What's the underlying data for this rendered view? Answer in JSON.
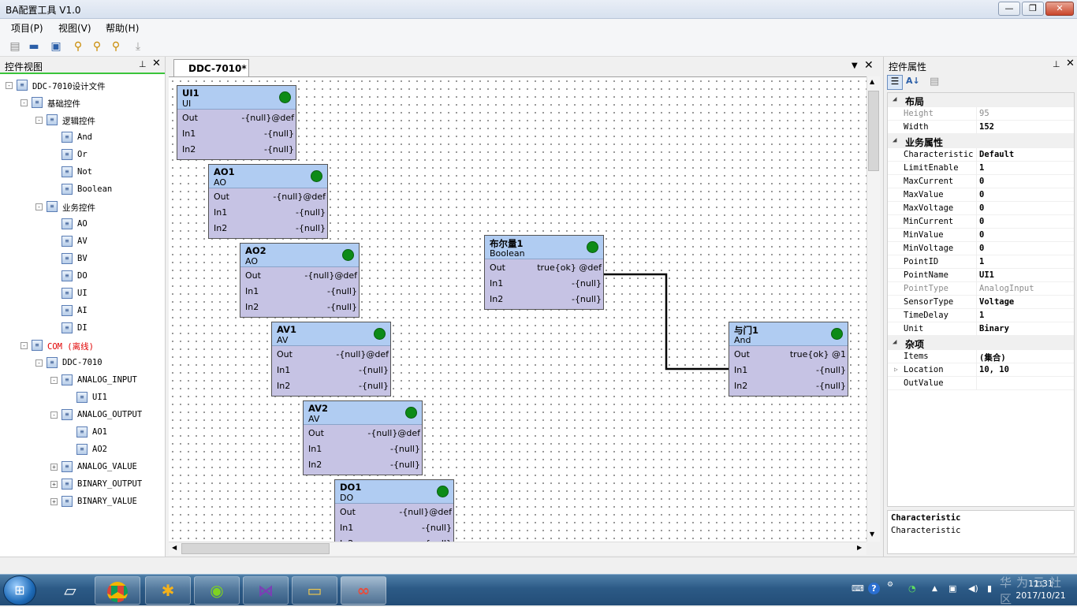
{
  "window": {
    "title": "BA配置工具 V1.0",
    "min": "—",
    "max": "❐",
    "close": "✕"
  },
  "menu": [
    "项目(P)",
    "视图(V)",
    "帮助(H)"
  ],
  "toolbar": [
    "print-icon",
    "open-icon",
    "save-icon",
    "zoom-in-icon",
    "zoom-out-icon",
    "zoom-fit-icon",
    "download-icon"
  ],
  "left_panel": {
    "title": "控件视图",
    "tree": [
      {
        "label": "DDC-7010设计文件",
        "level": 0,
        "exp": "-"
      },
      {
        "label": "基础控件",
        "level": 1,
        "exp": "-"
      },
      {
        "label": "逻辑控件",
        "level": 2,
        "exp": "-"
      },
      {
        "label": "And",
        "level": 3
      },
      {
        "label": "Or",
        "level": 3
      },
      {
        "label": "Not",
        "level": 3
      },
      {
        "label": "Boolean",
        "level": 3
      },
      {
        "label": "业务控件",
        "level": 2,
        "exp": "-"
      },
      {
        "label": "AO",
        "level": 3
      },
      {
        "label": "AV",
        "level": 3
      },
      {
        "label": "BV",
        "level": 3
      },
      {
        "label": "DO",
        "level": 3
      },
      {
        "label": "UI",
        "level": 3
      },
      {
        "label": "AI",
        "level": 3
      },
      {
        "label": "DI",
        "level": 3
      },
      {
        "label": "COM (离线)",
        "level": 1,
        "exp": "-",
        "red": true
      },
      {
        "label": "DDC-7010",
        "level": 2,
        "exp": "-"
      },
      {
        "label": "ANALOG_INPUT",
        "level": 3,
        "exp": "-"
      },
      {
        "label": "UI1",
        "level": 4
      },
      {
        "label": "ANALOG_OUTPUT",
        "level": 3,
        "exp": "-"
      },
      {
        "label": "AO1",
        "level": 4
      },
      {
        "label": "AO2",
        "level": 4
      },
      {
        "label": "ANALOG_VALUE",
        "level": 3,
        "exp": "+"
      },
      {
        "label": "BINARY_OUTPUT",
        "level": 3,
        "exp": "+"
      },
      {
        "label": "BINARY_VALUE",
        "level": 3,
        "exp": "+"
      }
    ]
  },
  "doc_tab": {
    "label": "DDC-7010*"
  },
  "nodes": [
    {
      "title": "UI1",
      "subtitle": "UI",
      "out": "-{null}@def",
      "in1": "-{null}",
      "in2": "-{null}"
    },
    {
      "title": "AO1",
      "subtitle": "AO",
      "out": "-{null}@def",
      "in1": "-{null}",
      "in2": "-{null}"
    },
    {
      "title": "AO2",
      "subtitle": "AO",
      "out": "-{null}@def",
      "in1": "-{null}",
      "in2": "-{null}"
    },
    {
      "title": "AV1",
      "subtitle": "AV",
      "out": "-{null}@def",
      "in1": "-{null}",
      "in2": "-{null}"
    },
    {
      "title": "AV2",
      "subtitle": "AV",
      "out": "-{null}@def",
      "in1": "-{null}",
      "in2": "-{null}"
    },
    {
      "title": "DO1",
      "subtitle": "DO",
      "out": "-{null}@def",
      "in1": "-{null}",
      "in2": "-{null}"
    },
    {
      "title": "布尔量1",
      "subtitle": "Boolean",
      "out": "true{ok} @def",
      "in1": "-{null}",
      "in2": "-{null}"
    },
    {
      "title": "与门1",
      "subtitle": "And",
      "out": "true{ok} @1",
      "in1": "-{null}",
      "in2": "-{null}"
    }
  ],
  "port_labels": {
    "out": "Out",
    "in1": "In1",
    "in2": "In2"
  },
  "right_panel": {
    "title": "控件属性",
    "categories": [
      {
        "name": "布局",
        "props": [
          [
            "Height",
            "95",
            true
          ],
          [
            "Width",
            "152",
            false
          ]
        ]
      },
      {
        "name": "业务属性",
        "props": [
          [
            "Characteristic",
            "Default",
            false
          ],
          [
            "LimitEnable",
            "1",
            false
          ],
          [
            "MaxCurrent",
            "0",
            false
          ],
          [
            "MaxValue",
            "0",
            false
          ],
          [
            "MaxVoltage",
            "0",
            false
          ],
          [
            "MinCurrent",
            "0",
            false
          ],
          [
            "MinValue",
            "0",
            false
          ],
          [
            "MinVoltage",
            "0",
            false
          ],
          [
            "PointID",
            "1",
            false
          ],
          [
            "PointName",
            "UI1",
            false
          ],
          [
            "PointType",
            "AnalogInput",
            true
          ],
          [
            "SensorType",
            "Voltage",
            false
          ],
          [
            "TimeDelay",
            "1",
            false
          ],
          [
            "Unit",
            "Binary",
            false
          ]
        ]
      },
      {
        "name": "杂项",
        "props": [
          [
            "Items",
            "(集合)",
            false
          ],
          [
            "Location",
            "10, 10",
            false
          ],
          [
            "OutValue",
            "",
            false
          ]
        ]
      }
    ],
    "description": {
      "title": "Characteristic",
      "text": "Characteristic"
    }
  },
  "taskbar": {
    "clock_time": "11:31",
    "clock_date": "2017/10/21",
    "watermark": "华为云社区"
  }
}
